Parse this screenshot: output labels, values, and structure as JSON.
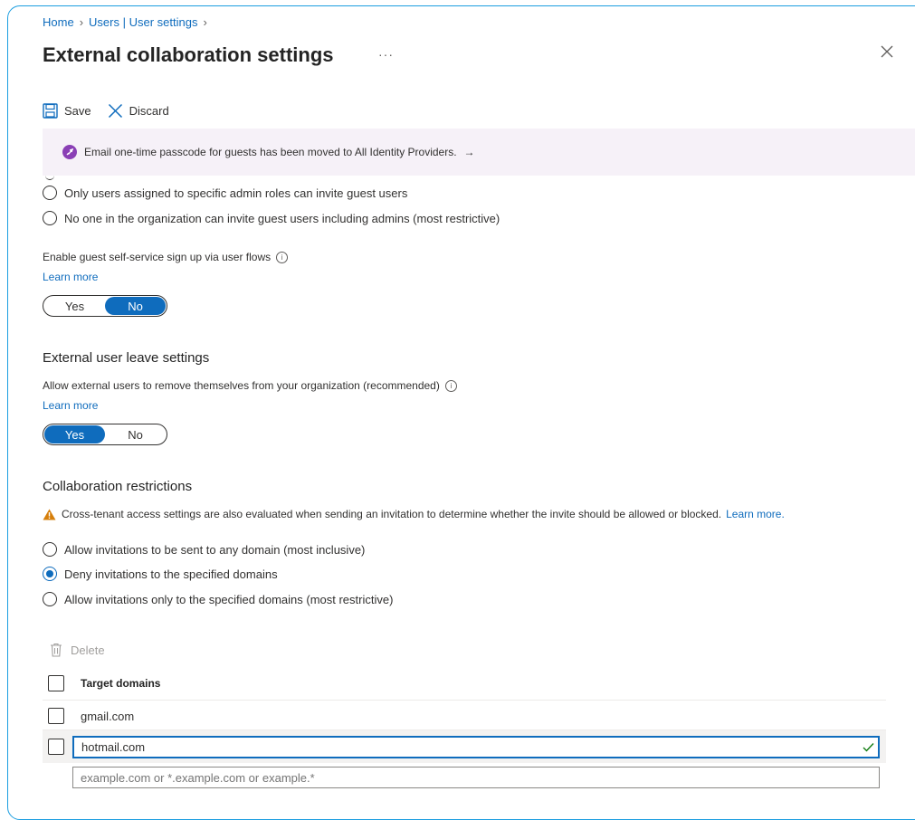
{
  "breadcrumb": {
    "items": [
      "Home",
      "Users | User settings"
    ]
  },
  "page": {
    "title": "External collaboration settings",
    "more": "···"
  },
  "toolbar": {
    "save_label": "Save",
    "discard_label": "Discard"
  },
  "banner": {
    "message": "Email one-time passcode for guests has been moved to All Identity Providers.",
    "arrow": "→"
  },
  "invite": {
    "options": [
      "Only users assigned to specific admin roles can invite guest users",
      "No one in the organization can invite guest users including admins (most restrictive)"
    ]
  },
  "self_service": {
    "label": "Enable guest self-service sign up via user flows",
    "learn_more": "Learn more",
    "toggle": {
      "yes": "Yes",
      "no": "No",
      "value": "No"
    }
  },
  "leave": {
    "title": "External user leave settings",
    "label": "Allow external users to remove themselves from your organization (recommended)",
    "learn_more": "Learn more",
    "toggle": {
      "yes": "Yes",
      "no": "No",
      "value": "Yes"
    }
  },
  "restrictions": {
    "title": "Collaboration restrictions",
    "warning": "Cross-tenant access settings are also evaluated when sending an invitation to determine whether the invite should be allowed or blocked.",
    "warning_link": "Learn more.",
    "options": [
      "Allow invitations to be sent to any domain (most inclusive)",
      "Deny invitations to the specified domains",
      "Allow invitations only to the specified domains (most restrictive)"
    ],
    "selected_index": 1
  },
  "domains": {
    "delete_label": "Delete",
    "column_header": "Target domains",
    "rows": [
      "gmail.com"
    ],
    "editing_value": "hotmail.com",
    "new_placeholder": "example.com or *.example.com or example.*"
  },
  "colors": {
    "accent": "#0f6cbd",
    "frame": "#1c9ee0",
    "banner_bg": "#f6f1f8",
    "warning": "#d67f0b",
    "success": "#107c10"
  }
}
